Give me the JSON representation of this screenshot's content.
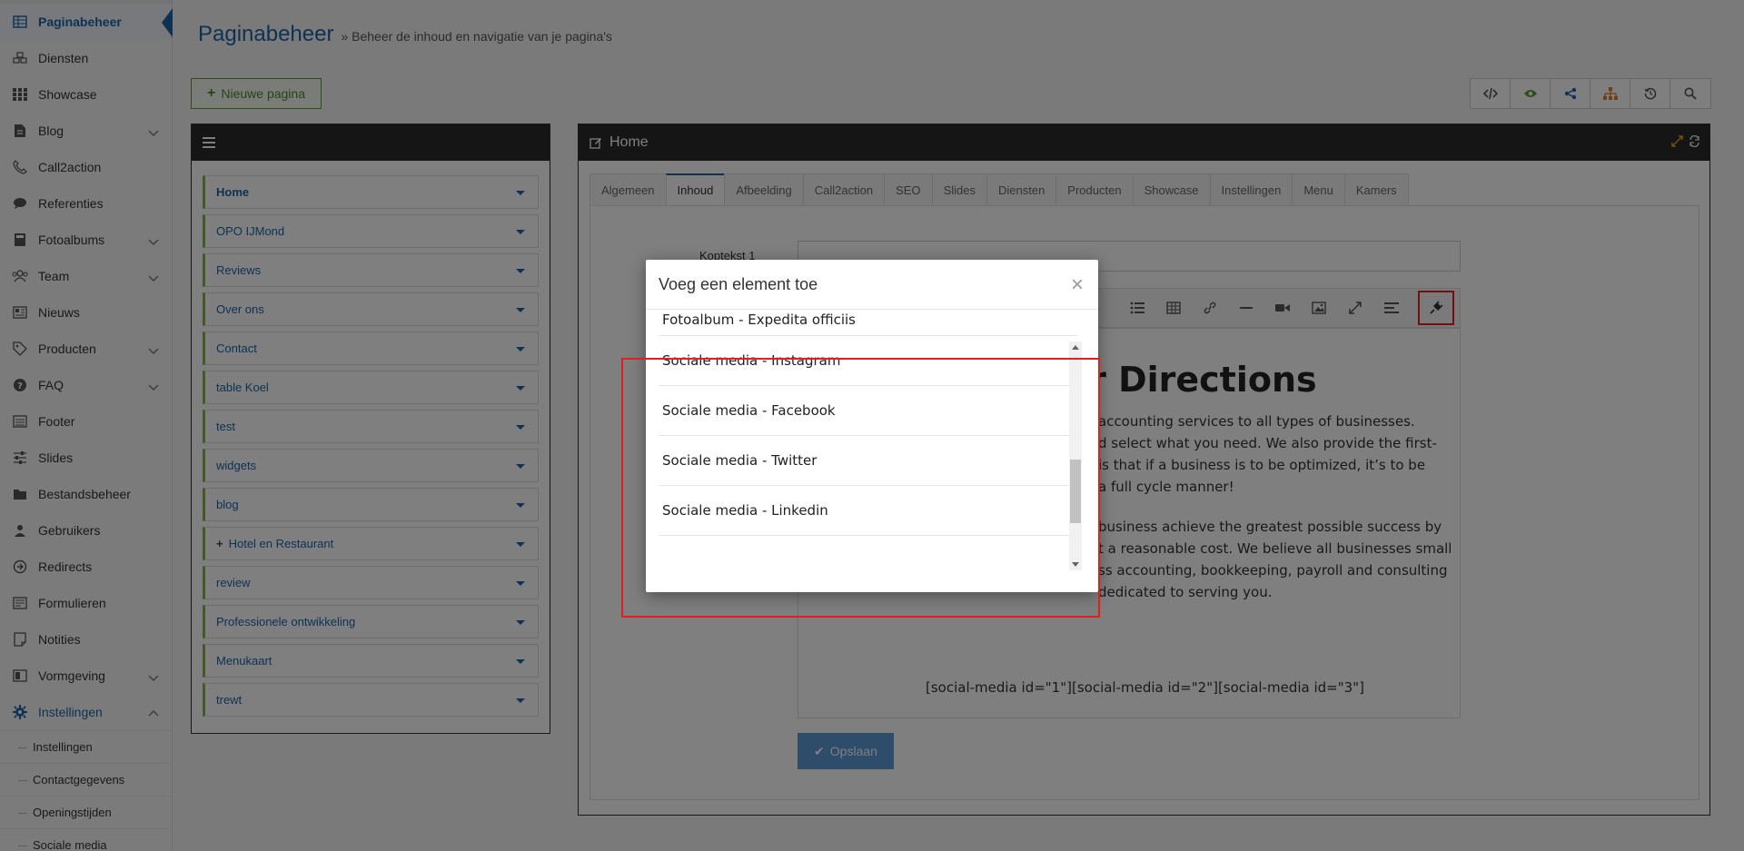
{
  "sidebar": {
    "items": [
      {
        "label": "Paginabeheer",
        "icon": "table-icon",
        "active": true
      },
      {
        "label": "Diensten",
        "icon": "cubes-icon"
      },
      {
        "label": "Showcase",
        "icon": "grid-icon"
      },
      {
        "label": "Blog",
        "icon": "file-icon",
        "chevron": true
      },
      {
        "label": "Call2action",
        "icon": "phone-icon"
      },
      {
        "label": "Referenties",
        "icon": "chat-icon"
      },
      {
        "label": "Fotoalbums",
        "icon": "book-icon",
        "chevron": true
      },
      {
        "label": "Team",
        "icon": "users-icon",
        "chevron": true
      },
      {
        "label": "Nieuws",
        "icon": "newspaper-icon"
      },
      {
        "label": "Producten",
        "icon": "tag-icon",
        "chevron": true
      },
      {
        "label": "FAQ",
        "icon": "question-icon",
        "chevron": true
      },
      {
        "label": "Footer",
        "icon": "list-icon"
      },
      {
        "label": "Slides",
        "icon": "sliders-icon"
      },
      {
        "label": "Bestandsbeheer",
        "icon": "folder-icon"
      },
      {
        "label": "Gebruikers",
        "icon": "user-icon"
      },
      {
        "label": "Redirects",
        "icon": "arrow-circle-icon"
      },
      {
        "label": "Formulieren",
        "icon": "form-icon"
      },
      {
        "label": "Notities",
        "icon": "note-icon"
      },
      {
        "label": "Vormgeving",
        "icon": "layout-icon",
        "chevron": true
      },
      {
        "label": "Instellingen",
        "icon": "gear-icon",
        "chevron": true,
        "open": true
      }
    ],
    "subitems": [
      "Instellingen",
      "Contactgegevens",
      "Openingstijden",
      "Sociale media"
    ]
  },
  "header": {
    "title": "Paginabeheer",
    "subtitle": "» Beheer de inhoud en navigatie van je pagina's"
  },
  "new_page_label": "Nieuwe pagina",
  "toolbar_icons": [
    "code-icon",
    "eye-icon",
    "share-icon",
    "sitemap-icon",
    "history-icon",
    "search-icon"
  ],
  "pages": [
    {
      "label": "Home",
      "bold": true
    },
    {
      "label": "OPO IJMond"
    },
    {
      "label": "Reviews"
    },
    {
      "label": "Over ons"
    },
    {
      "label": "Contact"
    },
    {
      "label": "table Koel"
    },
    {
      "label": "test"
    },
    {
      "label": "widgets"
    },
    {
      "label": "blog"
    },
    {
      "label": "Hotel en Restaurant",
      "plus": true
    },
    {
      "label": "review"
    },
    {
      "label": "Professionele ontwikkeling"
    },
    {
      "label": "Menukaart"
    },
    {
      "label": "trewt"
    }
  ],
  "editor": {
    "panel_title": "Home",
    "tabs": [
      "Algemeen",
      "Inhoud",
      "Afbeelding",
      "Call2action",
      "SEO",
      "Slides",
      "Diensten",
      "Producten",
      "Showcase",
      "Instellingen",
      "Menu",
      "Kamers"
    ],
    "active_tab": 1,
    "field_label": "Koptekst 1",
    "heading": "or Directions",
    "para1": [
      " accounting services to all types of businesses.",
      "d select what you need. We also provide the first-",
      " is that if a business is to be optimized, it’s to be",
      " a full cycle manner!"
    ],
    "para2": [
      "business achieve the greatest possible success by",
      "t a reasonable cost. We believe all businesses small",
      "ss accounting, bookkeeping, payroll and consulting",
      "dedicated to serving you."
    ],
    "shortcode": "[social-media id=\"1\"][social-media id=\"2\"][social-media id=\"3\"]",
    "save_label": "Opslaan"
  },
  "modal": {
    "title": "Voeg een element toe",
    "close": "×",
    "items": [
      "Fotoalbum - Expedita officiis",
      "Sociale media - Instagram",
      "Sociale media - Facebook",
      "Sociale media - Twitter",
      "Sociale media - Linkedin"
    ]
  },
  "colors": {
    "accent": "#1b64a8",
    "green": "#8bb14e",
    "highlight": "#e02020"
  }
}
